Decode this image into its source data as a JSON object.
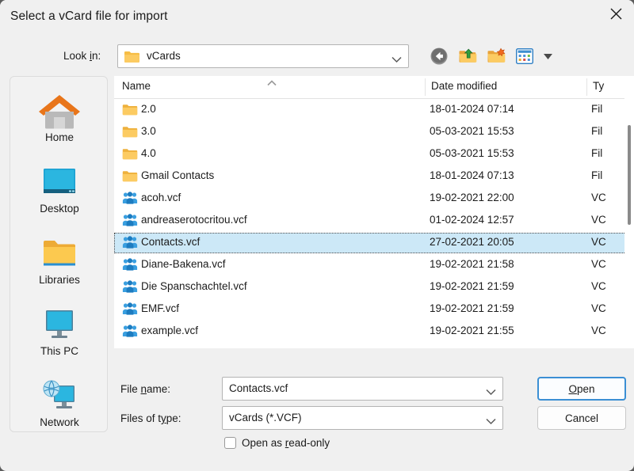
{
  "dialog": {
    "title": "Select a vCard file for import",
    "close_icon": "close-icon"
  },
  "lookin": {
    "label_pre": "Look ",
    "label_accel": "i",
    "label_post": "n:",
    "value": "vCards",
    "dropdown_icon": "chevron-down-icon"
  },
  "toolbar": {
    "back_label": "Back",
    "up_label": "Up One Level",
    "newfolder_label": "Create New Folder",
    "views_label": "Views",
    "views_caret": "caret-down-icon"
  },
  "places": [
    {
      "label": "Home",
      "icon": "home-icon"
    },
    {
      "label": "Desktop",
      "icon": "desktop-icon"
    },
    {
      "label": "Libraries",
      "icon": "folder-icon"
    },
    {
      "label": "This PC",
      "icon": "computer-icon"
    },
    {
      "label": "Network",
      "icon": "network-icon"
    }
  ],
  "filelist": {
    "columns": [
      {
        "label": "Name",
        "sort": "ascending"
      },
      {
        "label": "Date modified"
      },
      {
        "label": "Ty"
      }
    ],
    "rows": [
      {
        "name": "2.0",
        "date": "18-01-2024 07:14",
        "type": "Fil",
        "kind": "folder",
        "selected": false
      },
      {
        "name": "3.0",
        "date": "05-03-2021 15:53",
        "type": "Fil",
        "kind": "folder",
        "selected": false
      },
      {
        "name": "4.0",
        "date": "05-03-2021 15:53",
        "type": "Fil",
        "kind": "folder",
        "selected": false
      },
      {
        "name": "Gmail Contacts",
        "date": "18-01-2024 07:13",
        "type": "Fil",
        "kind": "folder",
        "selected": false
      },
      {
        "name": "acoh.vcf",
        "date": "19-02-2021 22:00",
        "type": "VC",
        "kind": "vcard",
        "selected": false
      },
      {
        "name": "andreaserotocritou.vcf",
        "date": "01-02-2024 12:57",
        "type": "VC",
        "kind": "vcard",
        "selected": false
      },
      {
        "name": "Contacts.vcf",
        "date": "27-02-2021 20:05",
        "type": "VC",
        "kind": "vcard",
        "selected": true
      },
      {
        "name": "Diane-Bakena.vcf",
        "date": "19-02-2021 21:58",
        "type": "VC",
        "kind": "vcard",
        "selected": false
      },
      {
        "name": "Die Spanschachtel.vcf",
        "date": "19-02-2021 21:59",
        "type": "VC",
        "kind": "vcard",
        "selected": false
      },
      {
        "name": "EMF.vcf",
        "date": "19-02-2021 21:59",
        "type": "VC",
        "kind": "vcard",
        "selected": false
      },
      {
        "name": "example.vcf",
        "date": "19-02-2021 21:55",
        "type": "VC",
        "kind": "vcard",
        "selected": false
      }
    ]
  },
  "form": {
    "filename_label_pre": "File ",
    "filename_label_accel": "n",
    "filename_label_post": "ame:",
    "filename_value": "Contacts.vcf",
    "filetype_label_pre": "Files of t",
    "filetype_label_accel": "y",
    "filetype_label_post": "pe:",
    "filetype_value": "vCards (*.VCF)",
    "readonly_label_pre": "Open as ",
    "readonly_label_accel": "r",
    "readonly_label_post": "ead-only",
    "readonly_checked": false
  },
  "buttons": {
    "open_pre": "",
    "open_accel": "O",
    "open_post": "pen",
    "cancel_label": "Cancel"
  },
  "colors": {
    "accent": "#3b8fd4",
    "selection": "#cce8f7",
    "window_bg": "#f0f0f0",
    "folder": "#fcc34d"
  }
}
